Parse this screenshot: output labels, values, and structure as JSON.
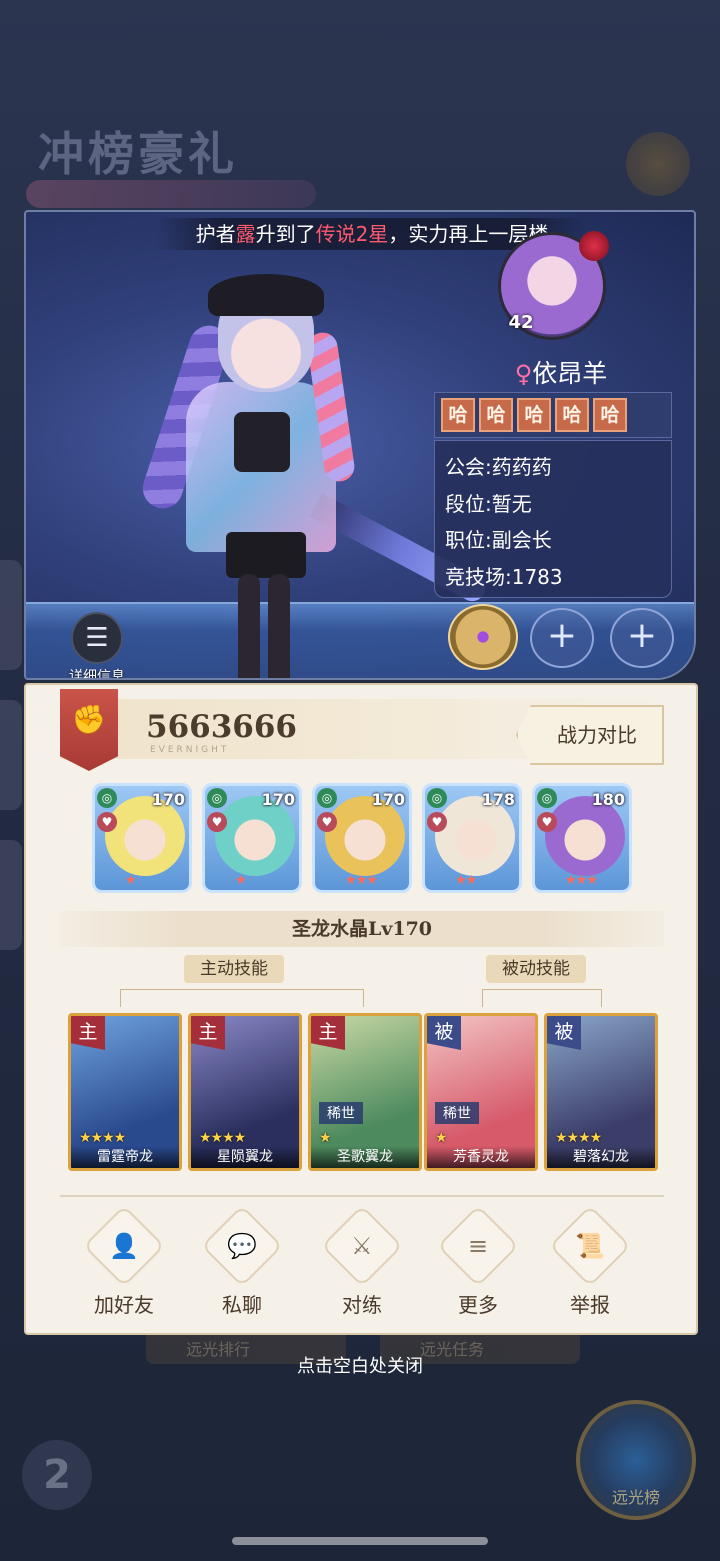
{
  "background": {
    "event_title": "冲榜豪礼",
    "bottom_buttons": [
      "远光排行",
      "远光任务"
    ],
    "corner_button": "远光榜"
  },
  "notice": {
    "prefix": "护者",
    "name": "露",
    "middle": "升到了",
    "rank": "传说2星",
    "suffix": "，实力再上一层楼"
  },
  "detail_button": {
    "label": "详细信息"
  },
  "player": {
    "level": "42",
    "gender_symbol": "♀",
    "name": "依昂羊",
    "title_tags": [
      "哈",
      "哈",
      "哈",
      "哈",
      "哈"
    ],
    "info": {
      "guild": "公会:药药药",
      "rank": "段位:暂无",
      "position": "职位:副会长",
      "arena": "竞技场:1783"
    }
  },
  "power": {
    "value": "5663666",
    "watermark": "EVERNIGHT",
    "compare_label": "战力对比"
  },
  "heroes": [
    {
      "level": "170",
      "stars": "★",
      "color": "#f1e27a"
    },
    {
      "level": "170",
      "stars": "★",
      "color": "#6fd0c8"
    },
    {
      "level": "170",
      "stars": "★★★",
      "color": "#e9c35a"
    },
    {
      "level": "178",
      "stars": "★★",
      "color": "#efe6d8"
    },
    {
      "level": "180",
      "stars": "★★★",
      "color": "#9a6ad0"
    }
  ],
  "crystal": {
    "label": "圣龙水晶Lv170"
  },
  "skills": {
    "active_label": "主动技能",
    "passive_label": "被动技能"
  },
  "dragons": [
    {
      "type": "主",
      "name": "雷霆帝龙",
      "stars": "★★★★",
      "rare": "",
      "colors": [
        "#2a4a8e",
        "#6fa2e0"
      ]
    },
    {
      "type": "主",
      "name": "星陨翼龙",
      "stars": "★★★★",
      "rare": "",
      "colors": [
        "#2a2f5e",
        "#8a88c8"
      ]
    },
    {
      "type": "主",
      "name": "圣歌翼龙",
      "stars": "★",
      "rare": "稀世",
      "colors": [
        "#4d8a5e",
        "#c9d9a4"
      ]
    },
    {
      "type": "被",
      "name": "芳香灵龙",
      "stars": "★",
      "rare": "稀世",
      "colors": [
        "#d65a6a",
        "#f2c4c4"
      ]
    },
    {
      "type": "被",
      "name": "碧落幻龙",
      "stars": "★★★★",
      "rare": "",
      "colors": [
        "#3c3e6a",
        "#8aa6c8"
      ]
    }
  ],
  "actions": [
    {
      "label": "加好友",
      "icon": "add-friend-icon",
      "glyph": "👤"
    },
    {
      "label": "私聊",
      "icon": "chat-icon",
      "glyph": "💬"
    },
    {
      "label": "对练",
      "icon": "crossed-swords-icon",
      "glyph": "⚔"
    },
    {
      "label": "更多",
      "icon": "more-list-icon",
      "glyph": "≡"
    },
    {
      "label": "举报",
      "icon": "report-scroll-icon",
      "glyph": "📜"
    }
  ],
  "close_hint": "点击空白处关闭"
}
